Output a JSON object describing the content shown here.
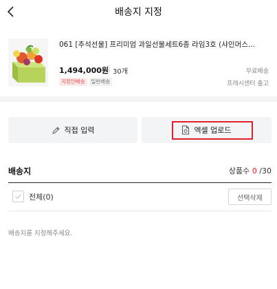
{
  "header": {
    "title": "배송지 지정",
    "back_icon": "chevron-left-icon"
  },
  "product": {
    "title": "061 [추석선물] 프리미엄 과일선물세트6종 라임3호 (샤인머스...",
    "price": "1,494,000원",
    "quantity": "30개",
    "badges": [
      "지정인배송",
      "일반배송"
    ],
    "shipping_fee": "무료배송",
    "shipping_origin": "프레시센터 출고"
  },
  "options": {
    "direct_label": "직접 입력",
    "direct_icon": "pencil-icon",
    "excel_label": "엑셀 업로드",
    "excel_icon": "file-upload-icon"
  },
  "destinations": {
    "title": "배송지",
    "count_label": "상품수",
    "count_current": "0",
    "count_total": "/30",
    "select_all_label": "전체(0)",
    "delete_selected_label": "선택삭제",
    "empty_message": "배송지를 지정해주세요."
  },
  "colors": {
    "accent": "#e21e2a",
    "button_bg": "#f3f4f6"
  }
}
